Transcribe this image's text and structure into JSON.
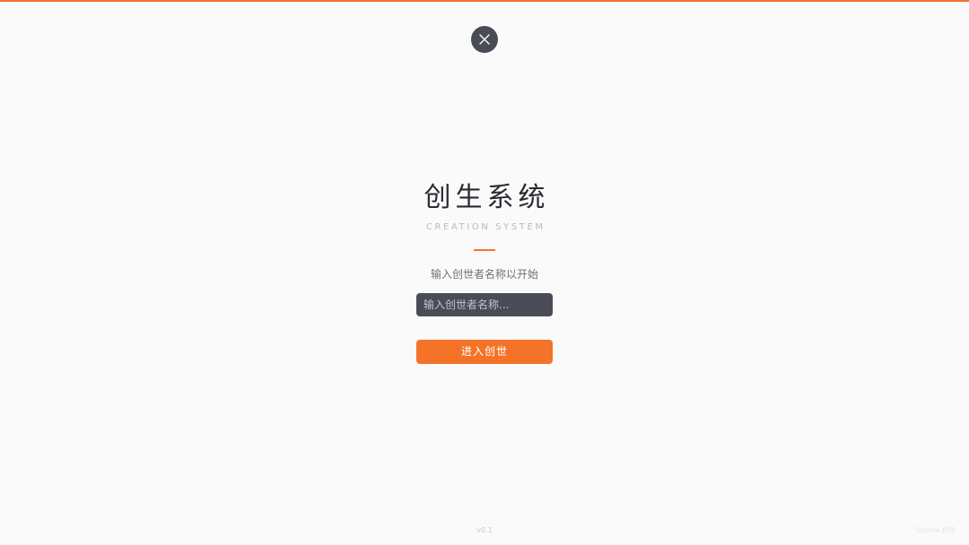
{
  "colors": {
    "accent": "#f47328",
    "surface_dark": "#4a4c55",
    "background": "#fafafb"
  },
  "header": {
    "close_icon": "close-icon"
  },
  "main": {
    "title": "创生系统",
    "subtitle": "CREATION SYSTEM",
    "prompt": "输入创世者名称以开始",
    "name_input": {
      "value": "",
      "placeholder": "输入创世者名称..."
    },
    "enter_button_label": "进入创世"
  },
  "footer": {
    "version": "v0.1",
    "watermark": "Sophia 创生"
  }
}
